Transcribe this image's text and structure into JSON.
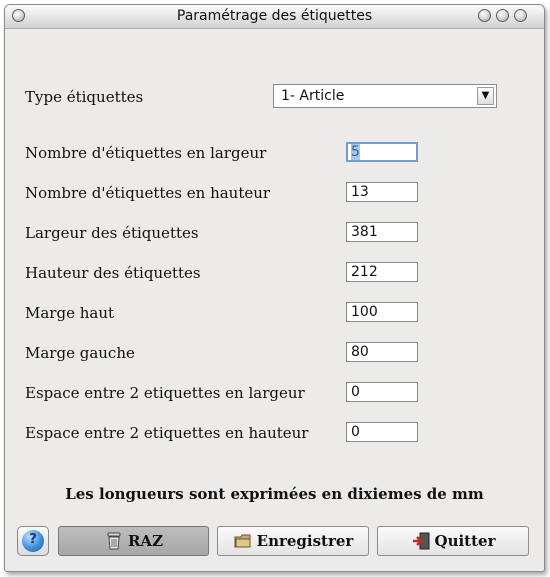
{
  "window": {
    "title": "Paramétrage des étiquettes"
  },
  "form": {
    "type_label": "Type étiquettes",
    "type_value": "1- Article",
    "fields": [
      {
        "label": "Nombre d'étiquettes en largeur",
        "value": "5"
      },
      {
        "label": "Nombre d'étiquettes en hauteur",
        "value": "13"
      },
      {
        "label": "Largeur des étiquettes",
        "value": "381"
      },
      {
        "label": "Hauteur des étiquettes",
        "value": "212"
      },
      {
        "label": "Marge haut",
        "value": "100"
      },
      {
        "label": "Marge gauche",
        "value": "80"
      },
      {
        "label": "Espace entre 2 etiquettes en largeur",
        "value": "0"
      },
      {
        "label": "Espace entre 2 etiquettes en hauteur",
        "value": "0"
      }
    ]
  },
  "note": "Les longueurs sont exprimées en dixiemes de mm",
  "buttons": {
    "raz": "RAZ",
    "save": "Enregistrer",
    "quit": "Quitter",
    "help_icon": "help-icon"
  }
}
